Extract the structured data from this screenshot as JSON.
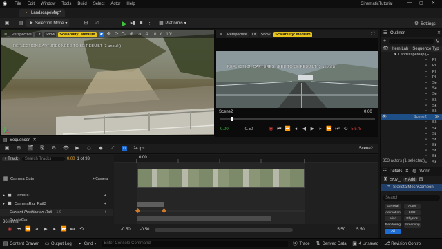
{
  "app": {
    "window_title": "CinematicTutorial",
    "menu": [
      "File",
      "Edit",
      "Window",
      "Tools",
      "Build",
      "Select",
      "Actor",
      "Help"
    ],
    "tab_label": "LandscapeMap*"
  },
  "toolbar": {
    "selection_mode": "Selection Mode",
    "platforms": "Platforms",
    "settings": "Settings"
  },
  "viewport_left": {
    "perspective": "Perspective",
    "lit": "Lit",
    "show": "Show",
    "scalability": "Scalability: Medium",
    "warning": "REFLECTION CAPTURES NEED TO BE REBUILT (3 unbuilt)",
    "grid_value": "10",
    "angle_value": "10°"
  },
  "viewport_right": {
    "perspective": "Perspective",
    "lit": "Lit",
    "show": "Show",
    "scalability": "Scalability: Medium",
    "warning": "REFLECTION CAPTURES NEED TO BE REBUILT (3 unbuilt)",
    "shot_name": "Scene2",
    "shot_time": "0.00",
    "time_left": "0.00",
    "time_left2": "-0.50",
    "time_right": "5.50",
    "time_end": "5.575"
  },
  "outliner": {
    "title": "Outliner",
    "col_item": "Item Lab",
    "col_type": "Sequence Typ",
    "root": "LandscapeMap (E",
    "rows": [
      "Pl",
      "Pl",
      "Pl",
      "Pl",
      "Se",
      "Se",
      "Se",
      "Sk",
      "Sk",
      "Sk",
      "Sk",
      "Sk",
      "St",
      "St",
      "St",
      "St",
      "St",
      "St"
    ],
    "selected_row": "Scene2",
    "selected_type": "Sk",
    "footer": "353 actors (1 selected)"
  },
  "details": {
    "tab_details": "Details",
    "tab_world": "World...",
    "actor_name": "SKM_",
    "add_label": "+ Add",
    "component": "SkeletalMeshCompon",
    "search_placeholder": "Search",
    "chips": [
      "General",
      "Actor",
      "Animation",
      "LOD",
      "Misc",
      "Physics",
      "Rendering",
      "Streaming",
      "All"
    ]
  },
  "sequencer": {
    "title": "Sequencer",
    "fps": "24 fps",
    "sequence_name": "Scene2",
    "add_track": "+ Track",
    "search_placeholder": "Search Tracks",
    "current_time": "0.00",
    "frame_counter": "1 of 93",
    "playhead_label": "0.00",
    "tracks": {
      "camera_cuts": "Camera Cuts",
      "camera_add": "+ Camera",
      "camera1": "Camera1",
      "camera_rig": "CameraRig_Rail3",
      "current_position": "Current Position on Rail",
      "current_position_value": "1.0",
      "sportscar": "SportsCar"
    },
    "item_count": "36 items",
    "range_start": "-0.50",
    "range_start2": "-0.50",
    "range_end": "5.50",
    "range_end2": "5.50"
  },
  "statusbar": {
    "content_drawer": "Content Drawer",
    "output_log": "Output Log",
    "cmd": "Cmd",
    "console_placeholder": "Enter Console Command",
    "trace": "Trace",
    "derived_data": "Derived Data",
    "unsaved": "4 Unsaved",
    "revision_control": "Revision Control"
  },
  "colors": {
    "accent_blue": "#1e6bd1",
    "play_green": "#3cc43c",
    "scalability_yellow": "#e8c41b",
    "playhead_red": "#d83b3b"
  }
}
